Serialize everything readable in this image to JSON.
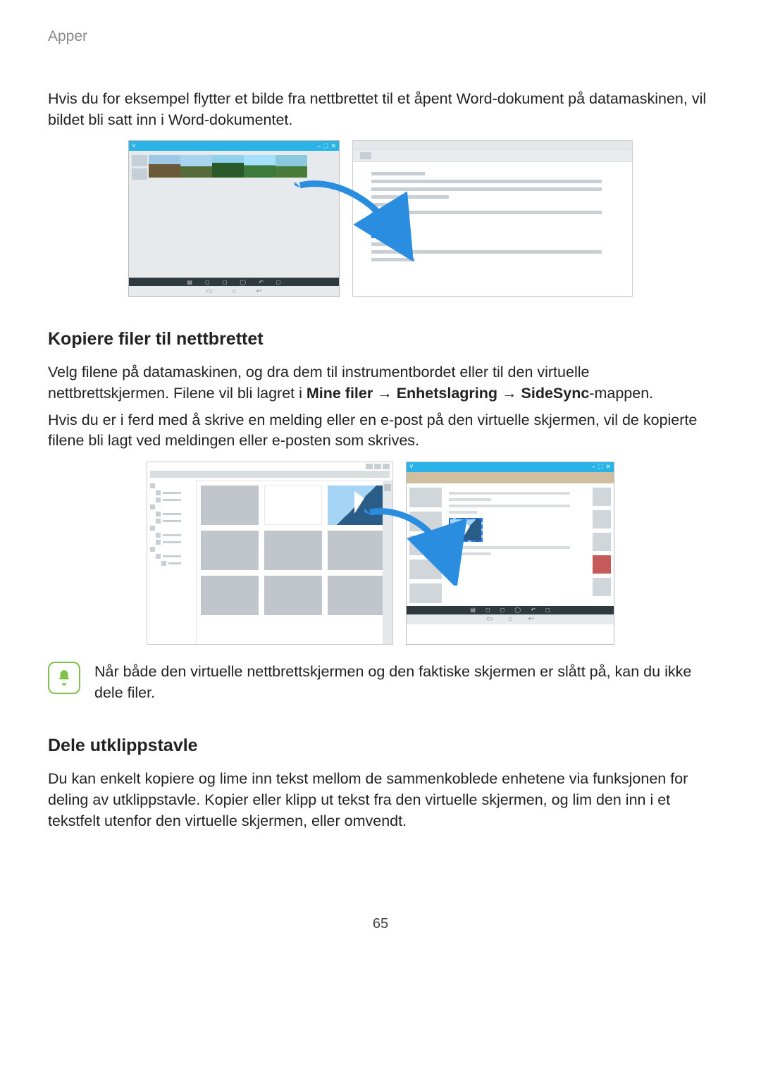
{
  "header": "Apper",
  "intro_p": "Hvis du for eksempel flytter et bilde fra nettbrettet til et åpent Word-dokument på datamaskinen, vil bildet bli satt inn i Word-dokumentet.",
  "sec1": {
    "heading": "Kopiere filer til nettbrettet",
    "p1_pre": "Velg filene på datamaskinen, og dra dem til instrumentbordet eller til den virtuelle nettbrettskjermen. Filene vil bli lagret i ",
    "path_a": "Mine filer",
    "arrow": " → ",
    "path_b": "Enhetslagring",
    "path_c": "SideSync",
    "p1_post": "-mappen.",
    "p2": "Hvis du er i ferd med å skrive en melding eller en e-post på den virtuelle skjermen, vil de kopierte filene bli lagt ved meldingen eller e-posten som skrives."
  },
  "note_text": "Når både den virtuelle nettbrettskjermen og den faktiske skjermen er slått på, kan du ikke dele filer.",
  "sec2": {
    "heading": "Dele utklippstavle",
    "p1": "Du kan enkelt kopiere og lime inn tekst mellom de sammenkoblede enhetene via funksjonen for deling av utklippstavle. Kopier eller klipp ut tekst fra den virtuelle skjermen, og lim den inn i et tekstfelt utenfor den virtuelle skjermen, eller omvendt."
  },
  "page_number": "65",
  "fig1": {
    "tablet_titlebar_icons": [
      "˅",
      "–",
      "⛶",
      "✕"
    ],
    "tablet_iconbar": [
      "▤",
      "◻",
      "◻",
      "◯",
      "↶",
      "◻"
    ],
    "tablet_navbar": [
      "▭",
      "⌂",
      "↩"
    ]
  },
  "fig2": {
    "tablet_titlebar_icons": [
      "˅",
      "–",
      "⛶",
      "✕"
    ],
    "tablet_iconbar": [
      "▤",
      "◻",
      "◻",
      "◯",
      "↶",
      "◻"
    ],
    "tablet_navbar": [
      "▭",
      "⌂",
      "↩"
    ]
  }
}
